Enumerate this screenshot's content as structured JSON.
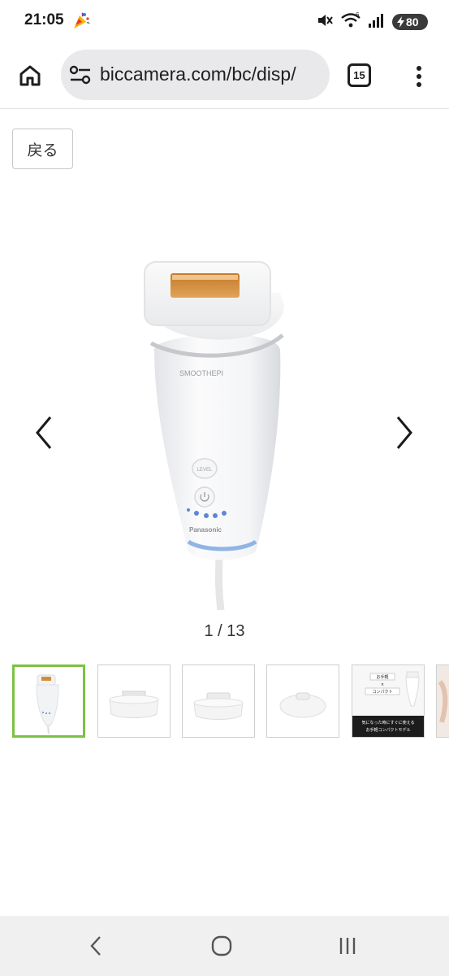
{
  "status_bar": {
    "time": "21:05",
    "battery": "80",
    "icons": [
      "party-popper-icon",
      "mute-icon",
      "wifi-icon",
      "signal-icon",
      "battery-icon"
    ]
  },
  "browser": {
    "url": "biccamera.com/bc/disp/",
    "tab_count": "15"
  },
  "page": {
    "back_label": "戻る",
    "pager": "1 / 13",
    "product": {
      "brand_top": "SMOOTHEPI",
      "button_label": "LEVEL",
      "brand_bottom": "Panasonic"
    },
    "thumbnail_5": {
      "line1": "お手軽",
      "line2": "×",
      "line3": "コンパクト",
      "caption1": "気になった時にすぐに使える",
      "caption2": "お手軽コンパクトモデル"
    }
  },
  "colors": {
    "selected_thumb_border": "#7cc242",
    "url_pill": "#e9e9ec",
    "nav_bar": "#f0f0f0"
  }
}
